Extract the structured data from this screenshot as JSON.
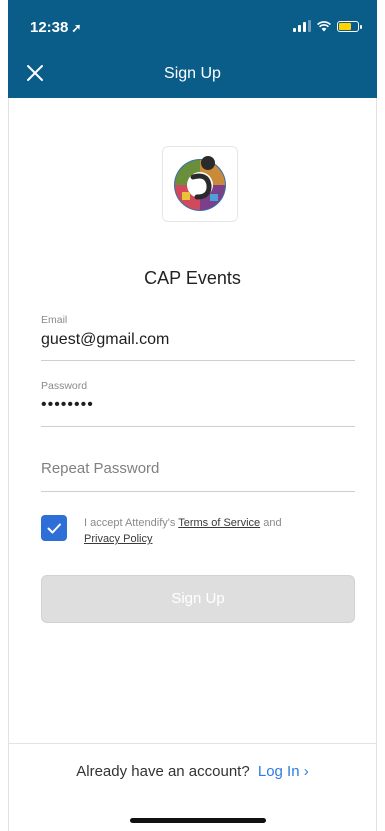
{
  "status_bar": {
    "time": "12:38",
    "location_icon": "location-arrow-icon"
  },
  "nav": {
    "title": "Sign Up",
    "close_icon": "close-icon"
  },
  "app": {
    "name": "CAP Events",
    "logo": "app-logo"
  },
  "form": {
    "email": {
      "label": "Email",
      "value": "guest@gmail.com"
    },
    "password": {
      "label": "Password",
      "value": "••••••••"
    },
    "repeat_password": {
      "placeholder": "Repeat Password",
      "value": ""
    },
    "terms": {
      "checked": true,
      "prefix": "I accept Attendify's ",
      "terms_link": "Terms of Service",
      "middle": " and",
      "privacy_link": "Privacy Policy"
    },
    "submit_label": "Sign Up"
  },
  "footer": {
    "prompt": "Already have an account?",
    "login_label": "Log In",
    "chevron": "›"
  },
  "colors": {
    "header_bg": "#0a5c89",
    "checkbox": "#2d6fd6",
    "link": "#2f7be0",
    "battery": "#ffd400"
  }
}
